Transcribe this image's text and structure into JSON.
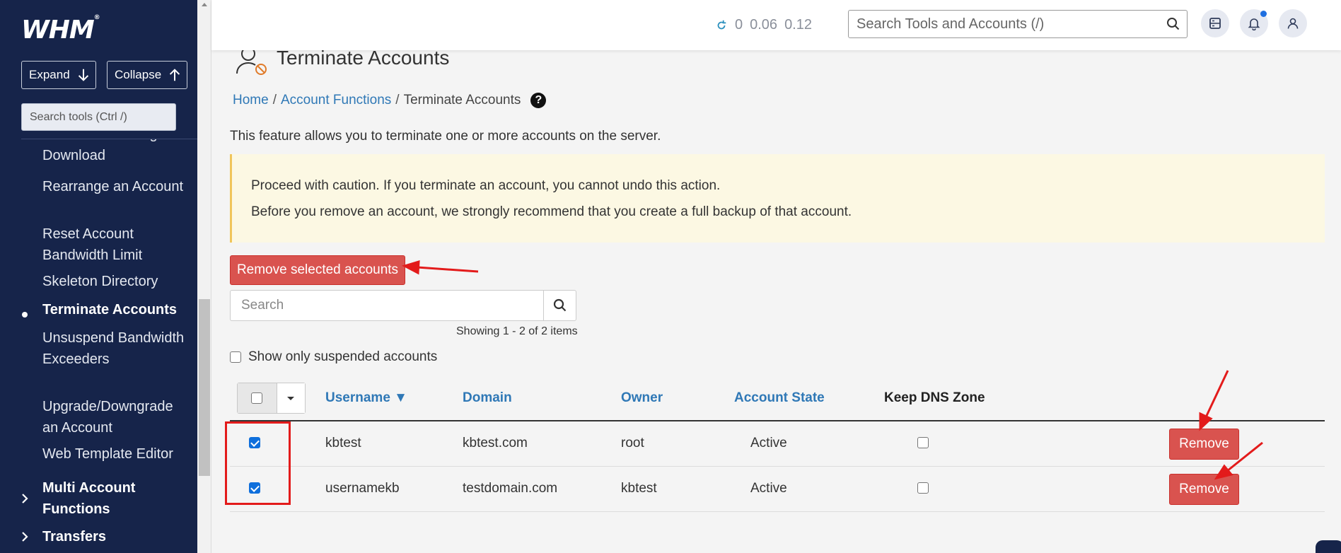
{
  "sidebar": {
    "logo": "WHM",
    "logo_mark": "®",
    "expand_label": "Expand",
    "collapse_label": "Collapse",
    "search_placeholder": "Search tools (Ctrl /)",
    "items": [
      {
        "label": "Raw NGINX® Log Download"
      },
      {
        "label": "Rearrange an Account"
      },
      {
        "label": "Reset Account Bandwidth Limit"
      },
      {
        "label": "Skeleton Directory"
      },
      {
        "label": "Terminate Accounts",
        "active": true
      },
      {
        "label": "Unsuspend Bandwidth Exceeders"
      },
      {
        "label": "Upgrade/Downgrade an Account"
      },
      {
        "label": "Web Template Editor"
      }
    ],
    "groups": [
      {
        "label": "Multi Account Functions",
        "icon": "chevron-right-icon"
      },
      {
        "label": "Transfers",
        "icon": "chevron-right-icon"
      }
    ]
  },
  "header": {
    "load": [
      "0",
      "0.06",
      "0.12"
    ],
    "search_placeholder": "Search Tools and Accounts (/)",
    "icons": [
      "server-icon",
      "bell-icon",
      "user-icon"
    ],
    "notification_dot_color": "#1f6fe0"
  },
  "page": {
    "title": "Terminate Accounts",
    "breadcrumb": {
      "home": "Home",
      "section": "Account Functions",
      "current": "Terminate Accounts",
      "sep": "/"
    },
    "intro": "This feature allows you to terminate one or more accounts on the server.",
    "warning_line1": "Proceed with caution. If you terminate an account, you cannot undo this action.",
    "warning_line2": "Before you remove an account, we strongly recommend that you create a full backup of that account.",
    "remove_selected_label": "Remove selected accounts",
    "search_placeholder": "Search",
    "showing": "Showing 1 - 2 of 2 items",
    "suspended_label": "Show only suspended accounts"
  },
  "table": {
    "headers": {
      "username": "Username ▼",
      "domain": "Domain",
      "owner": "Owner",
      "state": "Account State",
      "keep_dns": "Keep DNS Zone"
    },
    "rows": [
      {
        "selected": true,
        "username": "kbtest",
        "domain": "kbtest.com",
        "owner": "root",
        "state": "Active",
        "keep_dns": false,
        "action": "Remove"
      },
      {
        "selected": true,
        "username": "usernamekb",
        "domain": "testdomain.com",
        "owner": "kbtest",
        "state": "Active",
        "keep_dns": false,
        "action": "Remove"
      }
    ]
  },
  "colors": {
    "sidebar_bg": "#16244a",
    "link": "#2f78b6",
    "danger": "#d9534f",
    "warning_bg": "#fcf8e3",
    "annotation": "#e31b1b"
  }
}
